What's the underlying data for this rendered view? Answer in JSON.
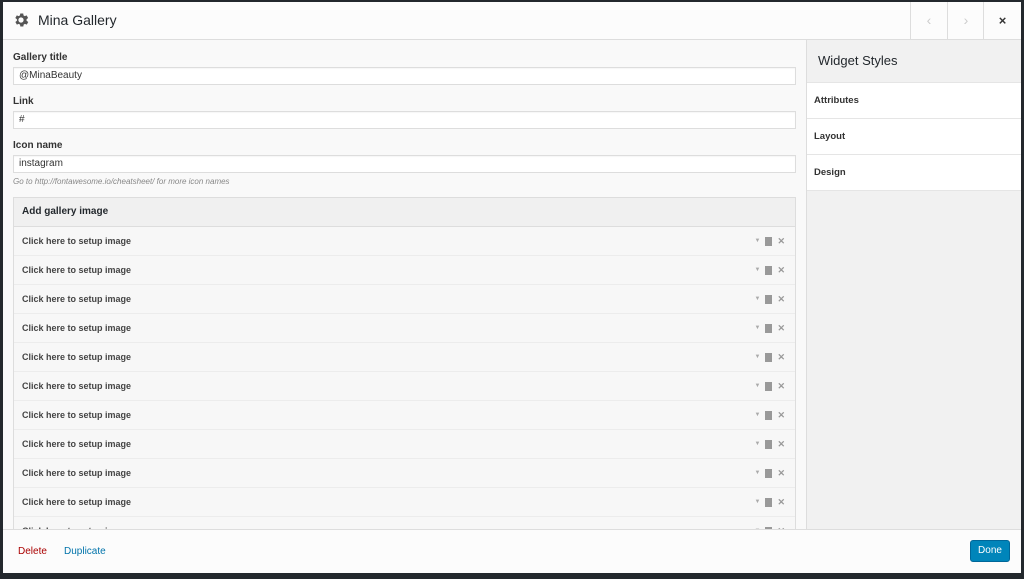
{
  "modal": {
    "title": "Mina Gallery",
    "icon": "gear-icon",
    "nav": {
      "prev": "‹",
      "next": "›",
      "close": "×"
    }
  },
  "form": {
    "gallery_title": {
      "label": "Gallery title",
      "value": "@MinaBeauty"
    },
    "link": {
      "label": "Link",
      "value": "#"
    },
    "icon_name": {
      "label": "Icon name",
      "value": "instagram",
      "hint": "Go to http://fontawesome.io/cheatsheet/ for more icon names"
    }
  },
  "gallery": {
    "header": "Add gallery image",
    "items": [
      "Click here to setup image",
      "Click here to setup image",
      "Click here to setup image",
      "Click here to setup image",
      "Click here to setup image",
      "Click here to setup image",
      "Click here to setup image",
      "Click here to setup image",
      "Click here to setup image",
      "Click here to setup image",
      "Click here to setup image"
    ]
  },
  "sidebar": {
    "title": "Widget Styles",
    "items": [
      "Attributes",
      "Layout",
      "Design"
    ]
  },
  "footer": {
    "delete": "Delete",
    "duplicate": "Duplicate",
    "done": "Done"
  },
  "colors": {
    "delete": "#aa0000",
    "link": "#0073aa",
    "primary": "#0085ba"
  }
}
